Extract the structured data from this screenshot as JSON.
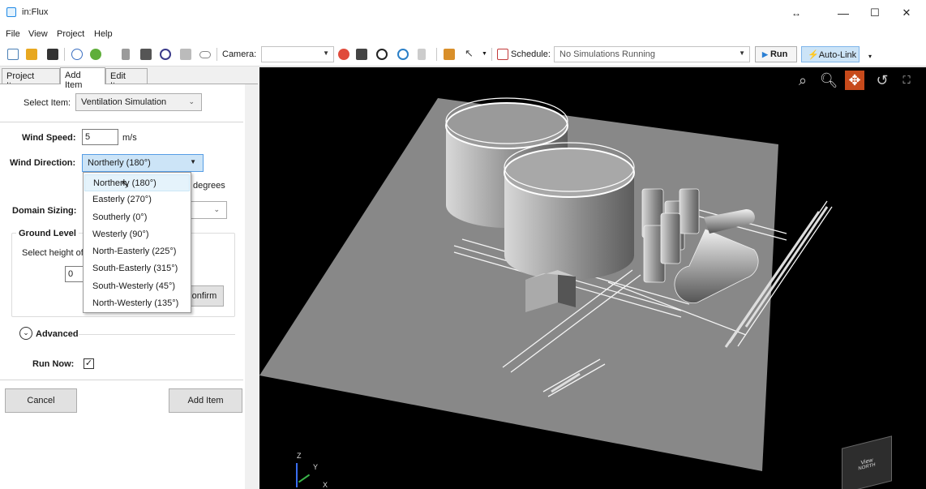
{
  "window": {
    "title": "in:Flux",
    "resize_glyph": "↔",
    "minimize": "—",
    "maximize": "☐",
    "close": "✕"
  },
  "menu": [
    "File",
    "View",
    "Project",
    "Help"
  ],
  "toolbar": {
    "camera_label": "Camera:",
    "camera_value": "",
    "schedule_label": "Schedule:",
    "schedule_value": "No Simulations Running",
    "run_label": "Run",
    "autolink_label": "Auto-Link",
    "icons": [
      "new-project-icon",
      "open-folder-icon",
      "save-icon",
      "info-icon",
      "add-circle-icon",
      "building-icon",
      "monitor-icon",
      "target-icon",
      "wind-turbine-icon",
      "cloud-icon",
      "camera-delete-icon",
      "camera-image-icon",
      "crosshair-icon",
      "move-icon",
      "document-icon",
      "hierarchy-icon",
      "pointer-icon",
      "calendar-icon"
    ]
  },
  "tabs": [
    {
      "label": "Project Items"
    },
    {
      "label": "Add Item"
    },
    {
      "label": "Edit Item"
    }
  ],
  "form": {
    "select_item_label": "Select Item:",
    "select_item_value": "Ventilation Simulation",
    "wind_speed_label": "Wind Speed:",
    "wind_speed_value": "5",
    "wind_speed_unit": "m/s",
    "wind_direction_label": "Wind Direction:",
    "wind_direction_value": "Northerly (180°)",
    "degrees_label": "degrees",
    "domain_sizing_label": "Domain Sizing:",
    "ground_level_label": "Ground Level",
    "select_height_label": "Select height of",
    "height_value": "0",
    "confirm_label": "Confirm",
    "advanced_label": "Advanced",
    "run_now_label": "Run Now:",
    "run_now_checked": true,
    "cancel_label": "Cancel",
    "add_item_label": "Add Item"
  },
  "wind_direction_options": [
    "Northerly (180°)",
    "Easterly (270°)",
    "Southerly (0°)",
    "Westerly (90°)",
    "North-Easterly (225°)",
    "South-Easterly (315°)",
    "South-Westerly (45°)",
    "North-Westerly (135°)"
  ],
  "viewport": {
    "tools": [
      "zoom-extents-icon",
      "zoom-icon",
      "pan-icon",
      "rotate-icon",
      "fullscreen-icon"
    ],
    "active_tool": "pan-icon",
    "axis_labels": {
      "z": "Z",
      "y": "Y",
      "x": "X"
    },
    "viewcube_top": "View",
    "viewcube_face": "NORTH",
    "accent_color": "#c74a1b"
  }
}
